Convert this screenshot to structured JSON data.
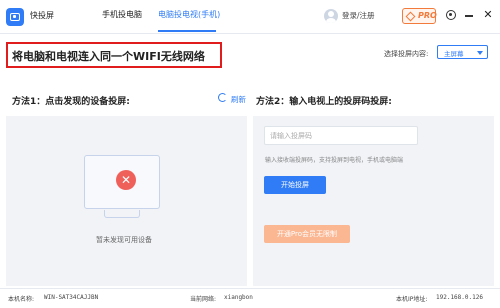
{
  "app": {
    "name": "快投屏"
  },
  "tabs": [
    {
      "label": "手机投电脑"
    },
    {
      "label": "电脑投电视(手机)",
      "active": true
    }
  ],
  "header": {
    "login_label": "登录/注册",
    "pro_label": "PRO",
    "headline": "将电脑和电视连入同一个WIFI无线网络",
    "select_label": "选择投屏内容:",
    "select_value": "主屏幕"
  },
  "method1": {
    "title": "方法1：点击发现的设备投屏:",
    "refresh_label": "刷新",
    "empty_text": "暂未发现可用设备"
  },
  "method2": {
    "title": "方法2：输入电视上的投屏码投屏:",
    "input_placeholder": "请输入投屏码",
    "hint": "输入接收端投屏码，支持投屏到电视，手机或电脑端",
    "start_button": "开始投屏",
    "vip_button": "开通Pro会员无限制"
  },
  "footer": {
    "name_label": "本机名称:",
    "name_value": "WIN-SAT34CAJJBN",
    "network_label": "当前网络:",
    "network_value": "xiangbon",
    "ip_label": "本机IP地址:",
    "ip_value": "192.168.0.126"
  },
  "colors": {
    "accent": "#2f7cf6",
    "headline_border": "#e11c1c",
    "pro": "#f27a3b",
    "vip_button": "#fbb692"
  },
  "icons": [
    "app-logo-icon",
    "avatar-icon",
    "diamond-icon",
    "settings-icon",
    "minimize-icon",
    "close-icon",
    "refresh-icon",
    "monitor-icon",
    "error-icon",
    "chevron-down-icon"
  ]
}
